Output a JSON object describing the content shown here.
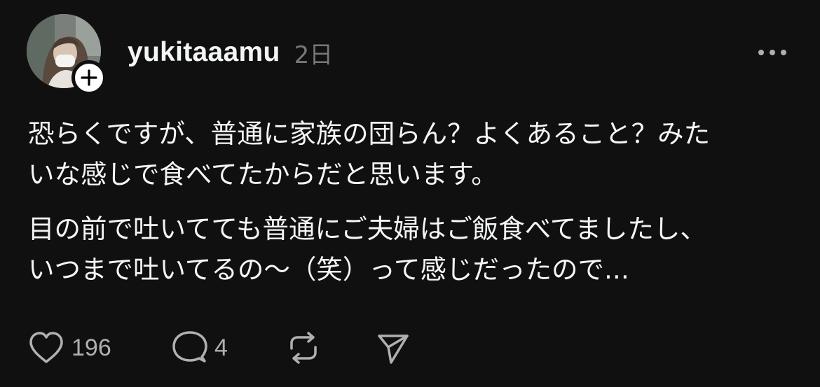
{
  "post": {
    "username": "yukitaaamu",
    "time": "2日",
    "paragraphs": [
      "恐らくですが、普通に家族の団らん？よくあること？みた\nいな感じで食べてたからだと思います。",
      "目の前で吐いてても普通にご夫婦はご飯食べてましたし、\nいつまで吐いてるの〜（笑）って感じだったので..."
    ]
  },
  "avatar": {
    "icon": "profile-photo",
    "badge_icon": "plus-icon"
  },
  "actions": {
    "like_count": "196",
    "reply_count": "4",
    "like_icon": "heart-icon",
    "reply_icon": "comment-icon",
    "repost_icon": "repost-icon",
    "share_icon": "send-icon",
    "more_icon": "more-icon"
  },
  "colors": {
    "background": "#101010",
    "text": "#f3f5f7",
    "secondary": "#777777",
    "icon": "#b0b0b0"
  }
}
